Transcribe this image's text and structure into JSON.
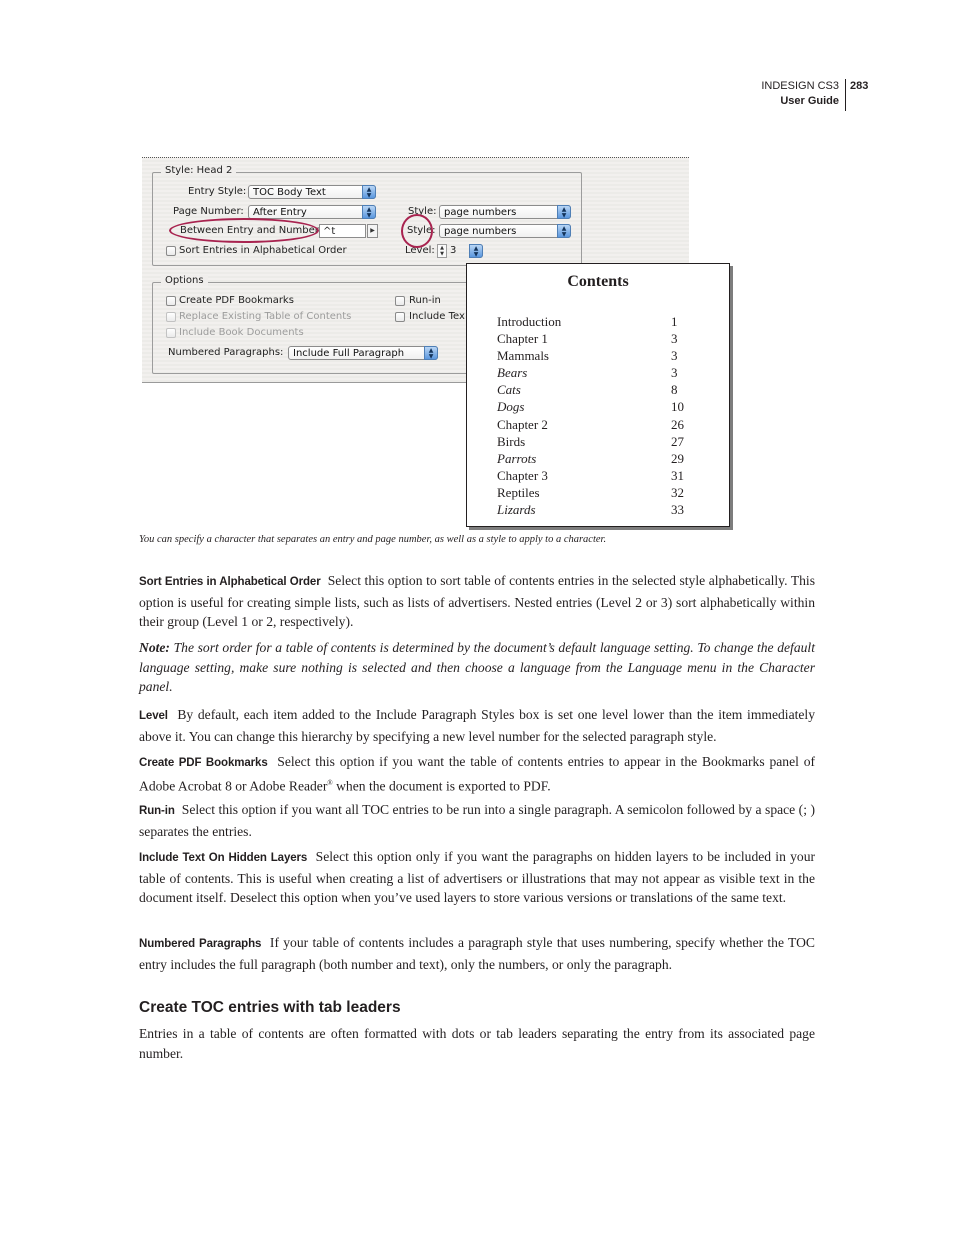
{
  "header": {
    "product": "INDESIGN CS3",
    "guide": "User Guide",
    "page_number": "283"
  },
  "dialog": {
    "style_group": {
      "legend": "Style: Head 2",
      "entry_style_label": "Entry Style:",
      "entry_style_value": "TOC Body Text",
      "page_number_label": "Page Number:",
      "page_number_value": "After Entry",
      "between_label": "Between Entry and Number:",
      "between_value": "^t",
      "sort_label": "Sort Entries in Alphabetical Order",
      "sort_checked": false,
      "style1_label": "Style:",
      "style1_value": "page numbers",
      "style2_label": "Style:",
      "style2_value": "page numbers",
      "level_label": "Level:",
      "level_value": "3"
    },
    "options_group": {
      "legend": "Options",
      "create_pdf_bookmarks": "Create PDF Bookmarks",
      "replace_existing": "Replace Existing Table of Contents",
      "include_book": "Include Book Documents",
      "run_in": "Run-in",
      "include_text": "Include Tex",
      "numbered_label": "Numbered Paragraphs:",
      "numbered_value": "Include Full Paragraph"
    },
    "callout_color": "#a8234f"
  },
  "toc_sample": {
    "title": "Contents",
    "entries": [
      {
        "entry": "Introduction",
        "page": "1",
        "italic": false
      },
      {
        "entry": "Chapter 1",
        "page": "3",
        "italic": false
      },
      {
        "entry": "Mammals",
        "page": "3",
        "italic": false
      },
      {
        "entry": "Bears",
        "page": "3",
        "italic": true
      },
      {
        "entry": "Cats",
        "page": "8",
        "italic": true
      },
      {
        "entry": "Dogs",
        "page": "10",
        "italic": true
      },
      {
        "entry": "Chapter 2",
        "page": "26",
        "italic": false
      },
      {
        "entry": "Birds",
        "page": "27",
        "italic": false
      },
      {
        "entry": "Parrots",
        "page": "29",
        "italic": true
      },
      {
        "entry": "Chapter 3",
        "page": "31",
        "italic": false
      },
      {
        "entry": "Reptiles",
        "page": "32",
        "italic": false
      },
      {
        "entry": "Lizards",
        "page": "33",
        "italic": true
      }
    ]
  },
  "caption": "You can specify a character that separates an entry and page number, as well as a style to apply to a character.",
  "sections": {
    "sort": {
      "term": "Sort Entries in Alphabetical Order",
      "text": "Select this option to sort table of contents entries in the selected style alphabetically. This option is useful for creating simple lists, such as lists of advertisers. Nested entries (Level 2 or 3) sort alphabetically within their group (Level 1 or 2, respectively)."
    },
    "note": {
      "label": "Note:",
      "text": "The sort order for a table of contents is determined by the document’s default language setting. To change the default language setting, make sure nothing is selected and then choose a language from the Language menu in the Character panel."
    },
    "level": {
      "term": "Level",
      "text": "By default, each item added to the Include Paragraph Styles box is set one level lower than the item immediately above it. You can change this hierarchy by specifying a new level number for the selected paragraph style."
    },
    "bookmarks": {
      "term": "Create PDF Bookmarks",
      "text_before": "Select this option if you want the table of contents entries to appear in the Bookmarks panel of Adobe Acrobat 8 or Adobe Reader",
      "sup": "®",
      "text_after": " when the document is exported to PDF."
    },
    "runin": {
      "term": "Run-in",
      "text": "Select this option if you want all TOC entries to be run into a single paragraph. A semicolon followed by a space (; ) separates the entries."
    },
    "hidden": {
      "term": "Include Text On Hidden Layers",
      "text": "Select this option only if you want the paragraphs on hidden layers to be included in your table of contents. This is useful when creating a list of advertisers or illustrations that may not appear as visible text in the document itself. Deselect this option when you’ve used layers to store various versions or translations of the same text."
    },
    "numbered": {
      "term": "Numbered Paragraphs",
      "text": "If your table of contents includes a paragraph style that uses numbering, specify whether the TOC entry includes the full paragraph (both number and text), only the numbers, or only the paragraph."
    }
  },
  "subheading": "Create TOC entries with tab leaders",
  "subheading_text": "Entries in a table of contents are often formatted with dots or tab leaders separating the entry from its associated page number."
}
